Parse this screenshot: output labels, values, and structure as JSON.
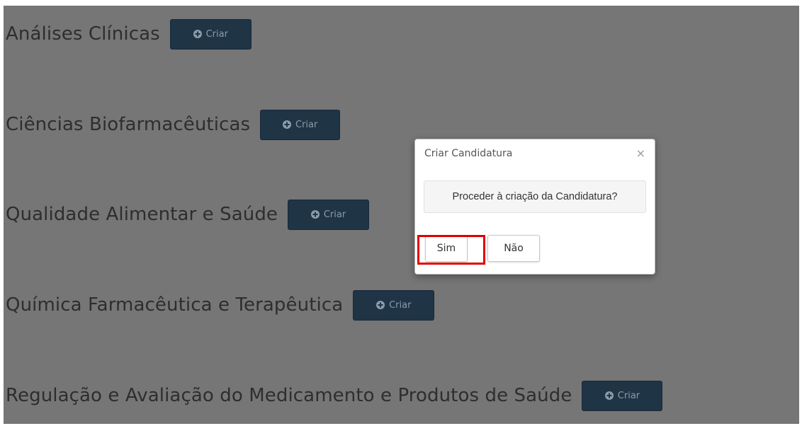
{
  "courses": [
    {
      "title": "Análises Clínicas",
      "button": "Criar"
    },
    {
      "title": "Ciências Biofarmacêuticas",
      "button": "Criar"
    },
    {
      "title": "Qualidade Alimentar e Saúde",
      "button": "Criar"
    },
    {
      "title": "Química Farmacêutica e Terapêutica",
      "button": "Criar"
    },
    {
      "title": "Regulação e Avaliação do Medicamento e Produtos de Saúde",
      "button": "Criar"
    }
  ],
  "modal": {
    "title": "Criar Candidatura",
    "close": "×",
    "message": "Proceder à criação da Candidatura?",
    "confirm_label": "Sim",
    "cancel_label": "Não"
  },
  "colors": {
    "overlay": "#767676",
    "button_bg": "#1f3445",
    "highlight": "#e10000"
  },
  "icons": {
    "criar": "plus-circle-icon",
    "close": "close-icon"
  }
}
